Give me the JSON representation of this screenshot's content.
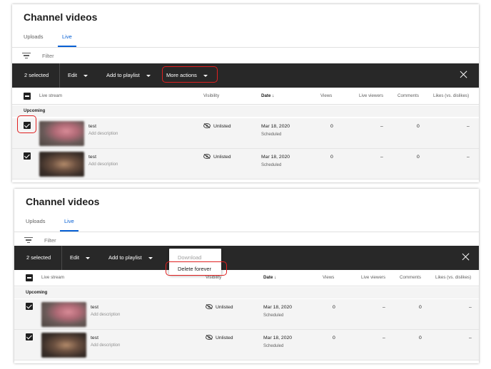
{
  "screens": [
    {
      "title": "Channel videos",
      "tabs": [
        {
          "label": "Uploads"
        },
        {
          "label": "Live"
        }
      ],
      "active_tab": "Live",
      "filter_placeholder": "Filter",
      "action_bar": {
        "selected_count": "2 selected",
        "edit_label": "Edit",
        "add_to_playlist_label": "Add to playlist",
        "more_actions_label": "More actions"
      },
      "columns": {
        "live_stream": "Live stream",
        "visibility": "Visibility",
        "date": "Date",
        "views": "Views",
        "live_viewers": "Live viewers",
        "comments": "Comments",
        "likes": "Likes (vs. dislikes)"
      },
      "section_label": "Upcoming",
      "rows": [
        {
          "title": "test",
          "description": "Add description",
          "visibility": "Unlisted",
          "date": "Mar 18, 2020",
          "status": "Scheduled",
          "views": "0",
          "live_viewers": "–",
          "comments": "0",
          "likes": "–"
        },
        {
          "title": "test",
          "description": "Add description",
          "visibility": "Unlisted",
          "date": "Mar 18, 2020",
          "status": "Scheduled",
          "views": "0",
          "live_viewers": "–",
          "comments": "0",
          "likes": "–"
        }
      ]
    },
    {
      "title": "Channel videos",
      "tabs": [
        {
          "label": "Uploads"
        },
        {
          "label": "Live"
        }
      ],
      "active_tab": "Live",
      "filter_placeholder": "Filter",
      "action_bar": {
        "selected_count": "2 selected",
        "edit_label": "Edit",
        "add_to_playlist_label": "Add to playlist"
      },
      "dropdown": {
        "download_label": "Download",
        "delete_forever_label": "Delete forever"
      },
      "columns": {
        "live_stream": "Live stream",
        "visibility": "Visibility",
        "date": "Date",
        "views": "Views",
        "live_viewers": "Live viewers",
        "comments": "Comments",
        "likes": "Likes (vs. dislikes)"
      },
      "section_label": "Upcoming",
      "rows": [
        {
          "title": "test",
          "description": "Add description",
          "visibility": "Unlisted",
          "date": "Mar 18, 2020",
          "status": "Scheduled",
          "views": "0",
          "live_viewers": "–",
          "comments": "0",
          "likes": "–"
        },
        {
          "title": "test",
          "description": "Add description",
          "visibility": "Unlisted",
          "date": "Mar 18, 2020",
          "status": "Scheduled",
          "views": "0",
          "live_viewers": "–",
          "comments": "0",
          "likes": "–"
        }
      ]
    }
  ],
  "highlight_color": "#e02020",
  "accent_color": "#065fd4",
  "action_bar_color": "#282828"
}
